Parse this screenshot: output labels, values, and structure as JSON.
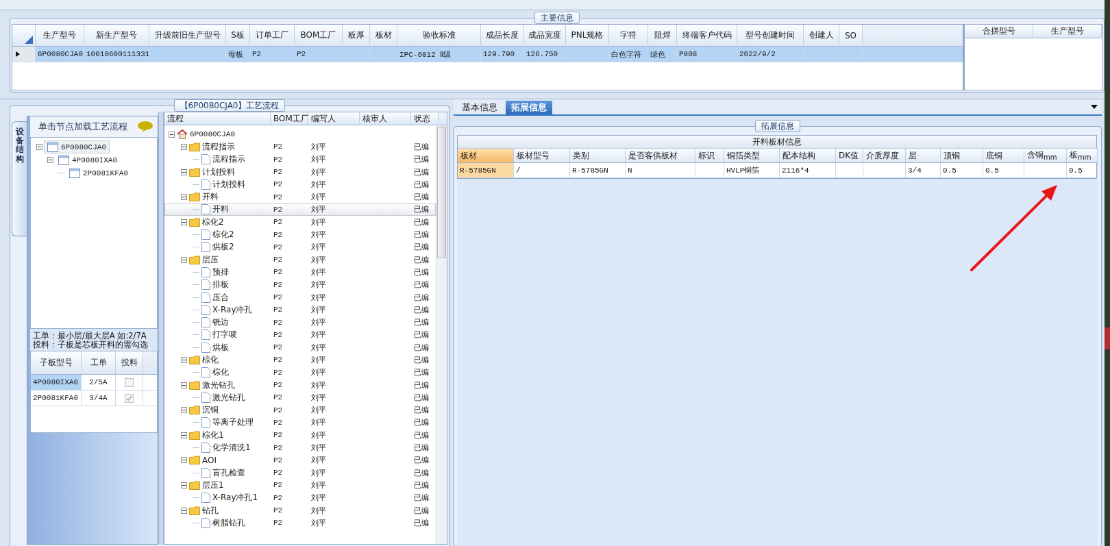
{
  "main_info": {
    "title": "主要信息",
    "columns": [
      "生产型号",
      "新生产型号",
      "升级前旧生产型号",
      "S板",
      "订单工厂",
      "BOM工厂",
      "板厚",
      "板材",
      "验收标准",
      "成品长度",
      "成品宽度",
      "PNL规格",
      "字符",
      "阻焊",
      "终端客户代码",
      "型号创建时间",
      "创建人",
      "SO"
    ],
    "rows": [
      {
        "selected": true,
        "cells": [
          "6P0080CJA0",
          "10010600111331",
          null,
          "母板",
          "P2",
          "P2",
          null,
          null,
          "IPC-6012 Ⅱ级",
          "129.790",
          "126.750",
          null,
          "白色字符",
          "绿色",
          "P008",
          "2022/9/2",
          null,
          null
        ]
      }
    ]
  },
  "merge_table": {
    "columns": [
      "合拼型号",
      "生产型号"
    ]
  },
  "process_flow": {
    "title": "【6P0080CJA0】工艺流程",
    "structure_tab": {
      "label": "设备结构",
      "selected": true
    },
    "hint": "单击节点加载工艺流程",
    "structure_tree": [
      {
        "label": "6P0080CJA0",
        "selected": true,
        "expanded": true,
        "children": [
          {
            "label": "4P0080IXA0",
            "selected": false,
            "expanded": true,
            "children": [
              {
                "label": "2P0081KFA0",
                "selected": false
              }
            ]
          }
        ]
      }
    ],
    "note_lines": [
      "工单：最小层/最大层A 如:2/7A",
      "投料：子板是芯板开料的需勾选"
    ],
    "sub_boards": {
      "columns": [
        "子板型号",
        "工单",
        "投料"
      ],
      "rows": [
        {
          "model": "4P0080IXA0",
          "order": "2/5A",
          "checked": false,
          "selected": true
        },
        {
          "model": "2P0081KFA0",
          "order": "3/4A",
          "checked": true,
          "selected": false
        }
      ]
    },
    "flow_grid": {
      "columns": [
        "流程",
        "BOM工厂",
        "编写人",
        "核审人",
        "状态"
      ],
      "tree": [
        {
          "kind": "root",
          "name": "6P0080CJA0",
          "selected": false,
          "expanded": true,
          "children": [
            {
              "kind": "group",
              "name": "流程指示",
              "bom": "P2",
              "writer": "刘平",
              "status": "已编",
              "selected": false,
              "expanded": true,
              "children": [
                {
                  "kind": "step",
                  "name": "流程指示",
                  "bom": "P2",
                  "writer": "刘平",
                  "status": "已编",
                  "selected": false
                }
              ]
            },
            {
              "kind": "group",
              "name": "计划投料",
              "bom": "P2",
              "writer": "刘平",
              "status": "已编",
              "selected": false,
              "expanded": true,
              "children": [
                {
                  "kind": "step",
                  "name": "计划投料",
                  "bom": "P2",
                  "writer": "刘平",
                  "status": "已编",
                  "selected": false
                }
              ]
            },
            {
              "kind": "group",
              "name": "开料",
              "bom": "P2",
              "writer": "刘平",
              "status": "已编",
              "selected": false,
              "expanded": true,
              "children": [
                {
                  "kind": "step",
                  "name": "开料",
                  "bom": "P2",
                  "writer": "刘平",
                  "status": "已编",
                  "selected": true
                }
              ]
            },
            {
              "kind": "group",
              "name": "棕化2",
              "bom": "P2",
              "writer": "刘平",
              "status": "已编",
              "selected": false,
              "expanded": true,
              "children": [
                {
                  "kind": "step",
                  "name": "棕化2",
                  "bom": "P2",
                  "writer": "刘平",
                  "status": "已编",
                  "selected": false
                },
                {
                  "kind": "step",
                  "name": "烘板2",
                  "bom": "P2",
                  "writer": "刘平",
                  "status": "已编",
                  "selected": false
                }
              ]
            },
            {
              "kind": "group",
              "name": "层压",
              "bom": "P2",
              "writer": "刘平",
              "status": "已编",
              "selected": false,
              "expanded": true,
              "children": [
                {
                  "kind": "step",
                  "name": "预排",
                  "bom": "P2",
                  "writer": "刘平",
                  "status": "已编",
                  "selected": false
                },
                {
                  "kind": "step",
                  "name": "排板",
                  "bom": "P2",
                  "writer": "刘平",
                  "status": "已编",
                  "selected": false
                },
                {
                  "kind": "step",
                  "name": "压合",
                  "bom": "P2",
                  "writer": "刘平",
                  "status": "已编",
                  "selected": false
                },
                {
                  "kind": "step",
                  "name": "X-Ray冲孔",
                  "bom": "P2",
                  "writer": "刘平",
                  "status": "已编",
                  "selected": false
                },
                {
                  "kind": "step",
                  "name": "铣边",
                  "bom": "P2",
                  "writer": "刘平",
                  "status": "已编",
                  "selected": false
                },
                {
                  "kind": "step",
                  "name": "打字唛",
                  "bom": "P2",
                  "writer": "刘平",
                  "status": "已编",
                  "selected": false
                },
                {
                  "kind": "step",
                  "name": "烘板",
                  "bom": "P2",
                  "writer": "刘平",
                  "status": "已编",
                  "selected": false
                }
              ]
            },
            {
              "kind": "group",
              "name": "棕化",
              "bom": "P2",
              "writer": "刘平",
              "status": "已编",
              "selected": false,
              "expanded": true,
              "children": [
                {
                  "kind": "step",
                  "name": "棕化",
                  "bom": "P2",
                  "writer": "刘平",
                  "status": "已编",
                  "selected": false
                }
              ]
            },
            {
              "kind": "group",
              "name": "激光钻孔",
              "bom": "P2",
              "writer": "刘平",
              "status": "已编",
              "selected": false,
              "expanded": true,
              "children": [
                {
                  "kind": "step",
                  "name": "激光钻孔",
                  "bom": "P2",
                  "writer": "刘平",
                  "status": "已编",
                  "selected": false
                }
              ]
            },
            {
              "kind": "group",
              "name": "沉铜",
              "bom": "P2",
              "writer": "刘平",
              "status": "已编",
              "selected": false,
              "expanded": true,
              "children": [
                {
                  "kind": "step",
                  "name": "等离子处理",
                  "bom": "P2",
                  "writer": "刘平",
                  "status": "已编",
                  "selected": false
                }
              ]
            },
            {
              "kind": "group",
              "name": "棕化1",
              "bom": "P2",
              "writer": "刘平",
              "status": "已编",
              "selected": false,
              "expanded": true,
              "children": [
                {
                  "kind": "step",
                  "name": "化学清洗1",
                  "bom": "P2",
                  "writer": "刘平",
                  "status": "已编",
                  "selected": false
                }
              ]
            },
            {
              "kind": "group",
              "name": "AOI",
              "bom": "P2",
              "writer": "刘平",
              "status": "已编",
              "selected": false,
              "expanded": true,
              "children": [
                {
                  "kind": "step",
                  "name": "盲孔检查",
                  "bom": "P2",
                  "writer": "刘平",
                  "status": "已编",
                  "selected": false
                }
              ]
            },
            {
              "kind": "group",
              "name": "层压1",
              "bom": "P2",
              "writer": "刘平",
              "status": "已编",
              "selected": false,
              "expanded": true,
              "children": [
                {
                  "kind": "step",
                  "name": "X-Ray冲孔1",
                  "bom": "P2",
                  "writer": "刘平",
                  "status": "已编",
                  "selected": false
                }
              ]
            },
            {
              "kind": "group",
              "name": "钻孔",
              "bom": "P2",
              "writer": "刘平",
              "status": "已编",
              "selected": false,
              "expanded": true,
              "children": [
                {
                  "kind": "step",
                  "name": "树脂钻孔",
                  "bom": "P2",
                  "writer": "刘平",
                  "status": "已编",
                  "selected": false
                }
              ]
            }
          ]
        }
      ]
    }
  },
  "detail_tabs": [
    {
      "label": "基本信息",
      "selected": false
    },
    {
      "label": "拓展信息",
      "selected": true
    }
  ],
  "ext_info": {
    "title": "拓展信息",
    "table_title": "开料板材信息",
    "columns": [
      {
        "label": "板材",
        "selected": true
      },
      {
        "label": "板材型号",
        "selected": false
      },
      {
        "label": "类别",
        "selected": false
      },
      {
        "label": "是否客供板材",
        "selected": false
      },
      {
        "label": "标识",
        "selected": false
      },
      {
        "label": "铜箔类型",
        "selected": false
      },
      {
        "label": "配本结构",
        "selected": false
      },
      {
        "label": "DK值",
        "selected": false
      },
      {
        "label": "介质厚度",
        "selected": false
      },
      {
        "label": "层",
        "selected": false
      },
      {
        "label": "顶铜",
        "selected": false
      },
      {
        "label": "底铜",
        "selected": false
      },
      {
        "label": "含铜$_{mm}$",
        "selected": false
      },
      {
        "label": "板$_{mm}$",
        "selected": false
      }
    ],
    "rows": [
      {
        "cells": [
          "R-5785GN",
          "/",
          "R-5785GN",
          "N",
          null,
          "HVLP铜箔",
          "2116*4",
          null,
          null,
          "3/4",
          "0.5",
          "0.5",
          null,
          "0.5"
        ]
      }
    ]
  }
}
